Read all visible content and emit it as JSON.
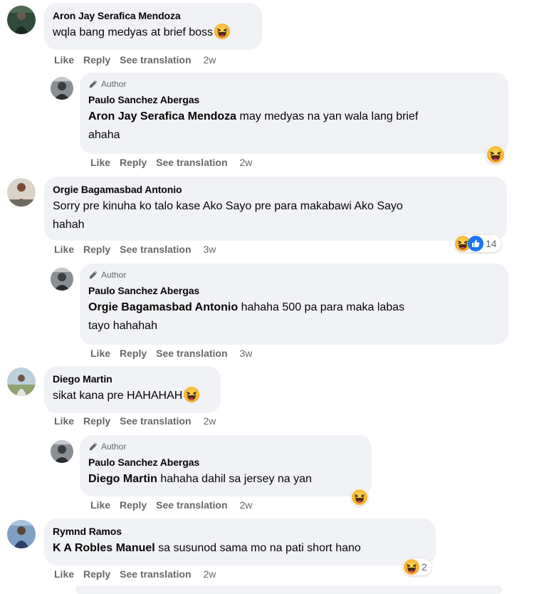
{
  "actions": {
    "like": "Like",
    "reply": "Reply",
    "see_translation": "See translation"
  },
  "author_badge": "Author",
  "comments": [
    {
      "author": "Aron Jay Serafica Mendoza",
      "text": "wqla bang medyas at brief boss",
      "time": "2w"
    },
    {
      "author": "Paulo Sanchez Abergas",
      "mention": "Aron Jay Serafica Mendoza",
      "text_line1": "may medyas na yan wala lang brief",
      "text_line2": "ahaha",
      "time": "2w"
    },
    {
      "author": "Orgie Bagamasbad Antonio",
      "text_line1": "Sorry pre kinuha ko talo kase Ako Sayo pre para makabawi Ako Sayo",
      "text_line2": "hahah",
      "time": "3w",
      "reaction_count": "14"
    },
    {
      "author": "Paulo Sanchez Abergas",
      "mention": "Orgie Bagamasbad Antonio",
      "text_line1": "hahaha 500 pa para maka labas",
      "text_line2": "tayo hahahah",
      "time": "3w"
    },
    {
      "author": "Diego Martin",
      "text": "sikat kana pre HAHAHAH",
      "time": "2w"
    },
    {
      "author": "Paulo Sanchez Abergas",
      "mention": "Diego Martin",
      "text": "hahaha dahil sa jersey na yan",
      "time": "2w"
    },
    {
      "author": "Rymnd Ramos",
      "mention": "K A Robles Manuel",
      "text": "sa susunod sama mo na pati short hano",
      "time": "2w",
      "reaction_count": "2"
    }
  ],
  "icons": [
    "pencil-icon",
    "haha-emoji-icon",
    "like-reaction-icon"
  ],
  "colors": {
    "bubble": "#f0f2f5",
    "secondary_text": "#65676b",
    "like_blue": "#1877f2",
    "haha_yellow": "#f7b125"
  }
}
